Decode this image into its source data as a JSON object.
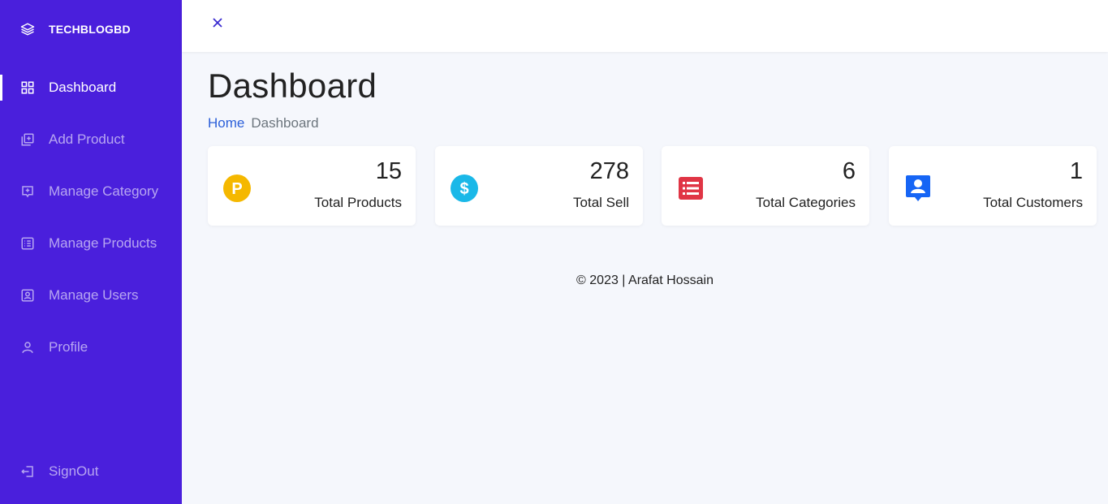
{
  "brand": {
    "name": "TECHBLOGBD",
    "icon": "layers-icon"
  },
  "sidebar": {
    "items": [
      {
        "label": "Dashboard",
        "icon": "grid-icon",
        "active": true
      },
      {
        "label": "Add Product",
        "icon": "add-box-icon",
        "active": false
      },
      {
        "label": "Manage Category",
        "icon": "box-down-icon",
        "active": false
      },
      {
        "label": "Manage Products",
        "icon": "list-icon",
        "active": false
      },
      {
        "label": "Manage Users",
        "icon": "user-badge-icon",
        "active": false
      },
      {
        "label": "Profile",
        "icon": "person-icon",
        "active": false
      }
    ],
    "signout": {
      "label": "SignOut",
      "icon": "signout-icon"
    }
  },
  "topbar": {
    "close_icon": "close-icon"
  },
  "page": {
    "title": "Dashboard"
  },
  "breadcrumb": {
    "home": "Home",
    "current": "Dashboard"
  },
  "cards": [
    {
      "value": "15",
      "label": "Total Products",
      "icon": "p-circle-icon",
      "color": "#f5b800"
    },
    {
      "value": "278",
      "label": "Total Sell",
      "icon": "dollar-circle-icon",
      "color": "#1ab8e8"
    },
    {
      "value": "6",
      "label": "Total Categories",
      "icon": "list-box-icon",
      "color": "#e03545"
    },
    {
      "value": "1",
      "label": "Total Customers",
      "icon": "user-pin-icon",
      "color": "#1665f5"
    }
  ],
  "footer": {
    "text": "© 2023 | Arafat Hossain"
  },
  "colors": {
    "sidebar": "#4a1fdc",
    "accent": "#2b5fd9",
    "background": "#f5f7fc"
  }
}
